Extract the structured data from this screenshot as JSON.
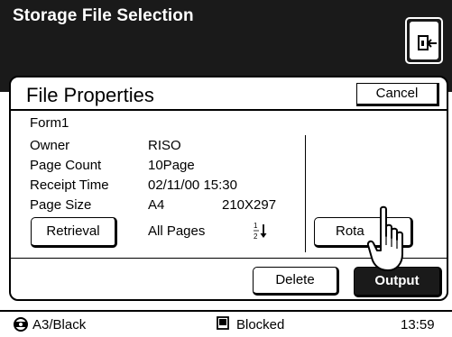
{
  "header": {
    "title": "Storage File Selection",
    "exit_icon": "exit-door-icon"
  },
  "panel": {
    "title": "File Properties",
    "cancel_label": "Cancel",
    "form_name": "Form1",
    "properties": [
      {
        "label": "Owner",
        "value": "RISO"
      },
      {
        "label": "Page Count",
        "value": "10Page"
      },
      {
        "label": "Receipt Time",
        "value": "02/11/00 15:30"
      },
      {
        "label": "Page Size",
        "value": "A4",
        "extra": "210X297"
      }
    ],
    "retrieval_label": "Retrieval",
    "pages_label": "All Pages",
    "pager_icon": "page-order-1-2-down-icon",
    "rotate_label": "Rota",
    "delete_label": "Delete",
    "output_label": "Output"
  },
  "status": {
    "paper": "A3/Black",
    "paper_icon": "printer-drum-icon",
    "blocked": "Blocked",
    "blocked_icon": "lock-square-icon",
    "time": "13:59"
  },
  "colors": {
    "header_bg": "#1a1a1a",
    "active_button_bg": "#1a1a1a"
  }
}
